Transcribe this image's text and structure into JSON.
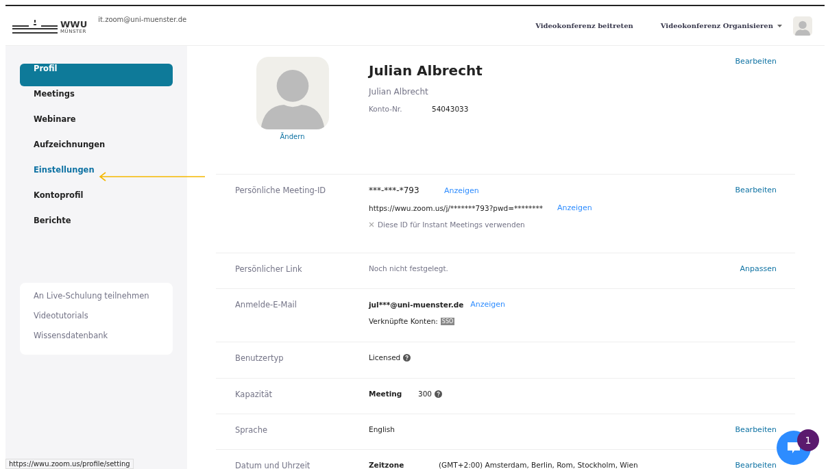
{
  "header": {
    "brand": "WWU",
    "brand_sub": "MÜNSTER",
    "account": "it.zoom@uni-muenster.de",
    "links": [
      {
        "label": "Videokonferenz beitreten",
        "dropdown": false
      },
      {
        "label": "Videokonferenz Organisieren",
        "dropdown": true
      }
    ]
  },
  "sidebar": {
    "items": [
      {
        "label": "Profil",
        "selected": true
      },
      {
        "label": "Meetings",
        "selected": false
      },
      {
        "label": "Webinare",
        "selected": false
      },
      {
        "label": "Aufzeichnungen",
        "selected": false
      },
      {
        "label": "Einstellungen",
        "selected": false,
        "highlighted": true
      },
      {
        "label": "Kontoprofil",
        "selected": false
      },
      {
        "label": "Berichte",
        "selected": false
      }
    ],
    "help": [
      "An Live-Schulung teilnehmen",
      "Videotutorials",
      "Wissensdatenbank"
    ]
  },
  "profile": {
    "name": "Julian Albrecht",
    "display_name": "Julian Albrecht",
    "account_label": "Konto-Nr.",
    "account_number": "54043033",
    "change": "Ändern",
    "action": "Bearbeiten"
  },
  "rows": [
    {
      "kind": "meeting_id",
      "label": "Persönliche Meeting-ID",
      "value": "***-***-*793",
      "reveal": "Anzeigen",
      "url": "https://wwu.zoom.us/j/*******793?pwd=********",
      "url_reveal": "Anzeigen",
      "option": "Diese ID für Instant Meetings verwenden",
      "option_checked": false,
      "action": "Bearbeiten"
    },
    {
      "kind": "plain",
      "label": "Persönlicher Link",
      "value": "Noch nicht festgelegt.",
      "muted": true,
      "action": "Anpassen"
    },
    {
      "kind": "email",
      "label": "Anmelde-E-Mail",
      "value": "jul***@uni-muenster.de",
      "reveal": "Anzeigen",
      "linked_label": "Verknüpfte Konten:",
      "linked_tag": "SSO"
    },
    {
      "kind": "help",
      "label": "Benutzertyp",
      "value": "Licensed"
    },
    {
      "kind": "capacity",
      "label": "Kapazität",
      "name": "Meeting",
      "value": "300"
    },
    {
      "kind": "plain",
      "label": "Sprache",
      "value": "English",
      "muted": false,
      "action": "Bearbeiten"
    },
    {
      "kind": "timezone",
      "label": "Datum und Uhrzeit",
      "name": "Zeitzone",
      "value": "(GMT+2:00) Amsterdam, Berlin, Rom, Stockholm, Wien",
      "action": "Bearbeiten"
    }
  ],
  "chat": {
    "badge": "1"
  },
  "status_bar": "https://wwu.zoom.us/profile/setting"
}
